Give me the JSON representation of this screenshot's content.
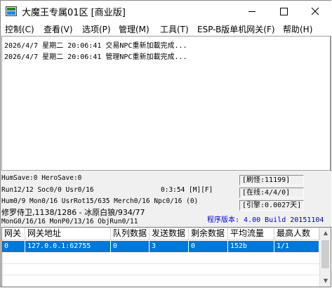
{
  "window": {
    "title": "大魔王专属01区 [商业版]",
    "controls": {
      "minimize": "minimize",
      "maximize": "maximize",
      "close": "close"
    }
  },
  "menu": [
    {
      "label": "控制(C)"
    },
    {
      "label": "查看(V)"
    },
    {
      "label": "选项(P)"
    },
    {
      "label": "管理(M)"
    },
    {
      "label": "工具(T)"
    },
    {
      "label": "ESP-B版单机网关(F)"
    },
    {
      "label": "帮助(H)"
    }
  ],
  "log": [
    "2026/4/7 星期二 20:06:41 交易NPC重新加載完成...",
    "2026/4/7 星期二 20:06:41 管理NPC重新加載完成..."
  ],
  "status": {
    "line1": "HumSave:0 HeroSave:0",
    "line2": "Run12/12 Soc0/0 Usr0/16",
    "time": "0:3:54 [M][F]",
    "line3": "Hum0/9 Mon0/16 UsrRot15/635 Merch0/16 Npc0/16 (0)",
    "line4": "修罗侍卫,1138/1286 - 冰原白狼/934/77",
    "line5": "MonG0/16/16 MonP0/13/16 ObjRun0/11",
    "refresh": "[刷怪:11199]",
    "online": "[在线:4/4/0]",
    "engine": "[引擎:0.0027天]",
    "version": "程序版本: 4.00 Build 20151104"
  },
  "table": {
    "columns": [
      "网关",
      "网关地址",
      "队列数据",
      "发送数据",
      "剩余数据",
      "平均流量",
      "最高人数"
    ],
    "rows": [
      [
        "0",
        "127.0.0.1:62755",
        "0",
        "3",
        "0",
        "152b",
        "1/1"
      ]
    ]
  },
  "colors": {
    "selection": "#0078d7",
    "version_text": "#0000c8"
  }
}
